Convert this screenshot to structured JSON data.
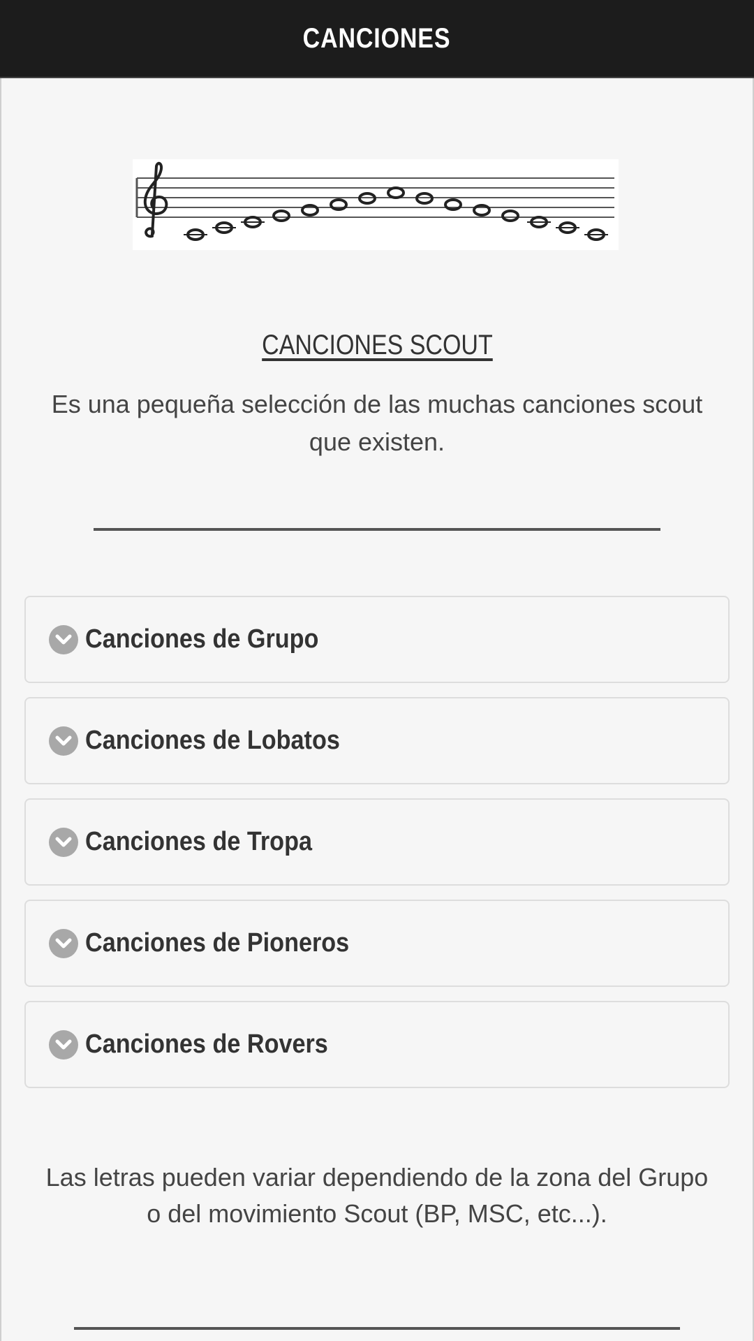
{
  "header": {
    "title": "CANCIONES"
  },
  "banner": {
    "icon": "music-staff-icon"
  },
  "section": {
    "title": "CANCIONES SCOUT",
    "intro": "Es una pequeña selección de las muchas canciones scout que existen."
  },
  "accordion": {
    "icon": "chevron-down-icon",
    "items": [
      {
        "label": "Canciones de Grupo"
      },
      {
        "label": "Canciones de Lobatos"
      },
      {
        "label": "Canciones de Tropa"
      },
      {
        "label": "Canciones de Pioneros"
      },
      {
        "label": "Canciones de Rovers"
      }
    ]
  },
  "footer": {
    "note": "Las letras pueden variar dependiendo de la zona del Grupo o del movimiento Scout (BP, MSC, etc...)."
  },
  "colors": {
    "header_bg": "#1c1c1c",
    "page_bg": "#f6f6f6",
    "icon_gray": "#a8a8a8"
  }
}
